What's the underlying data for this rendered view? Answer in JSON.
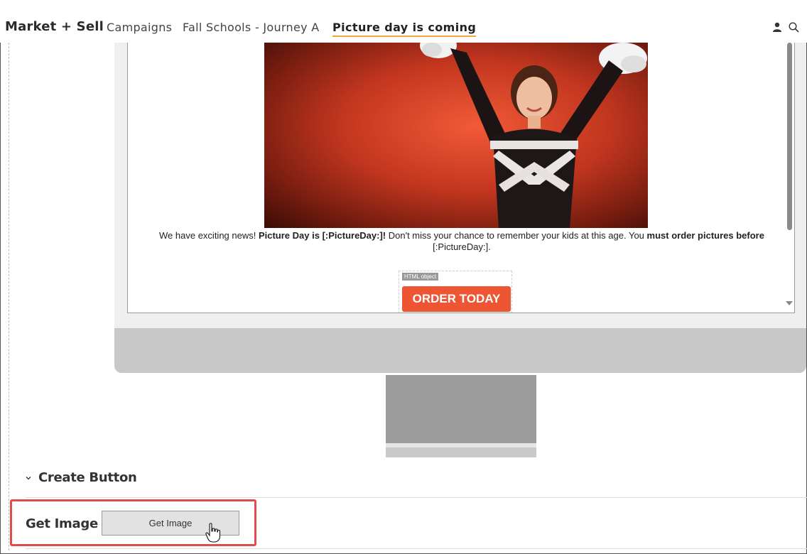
{
  "nav": {
    "brand": "Market + Sell",
    "breadcrumbs": [
      "Campaigns",
      "Fall Schools - Journey A",
      "Picture day is coming"
    ]
  },
  "email": {
    "text_parts": [
      "We have exciting news! ",
      "Picture Day is [:PictureDay:]!",
      " Don't miss your chance to remember your kids at this age. You ",
      "must order pictures before",
      " [:PictureDay:]."
    ],
    "html_object_tag": "HTML object",
    "order_button": "ORDER TODAY"
  },
  "section": {
    "title": "Create Button"
  },
  "get_image": {
    "label": "Get Image",
    "button": "Get Image"
  },
  "colors": {
    "accent_underline": "#f2a33a",
    "order_button": "#ee5533",
    "highlight_box": "#e24b4b"
  }
}
